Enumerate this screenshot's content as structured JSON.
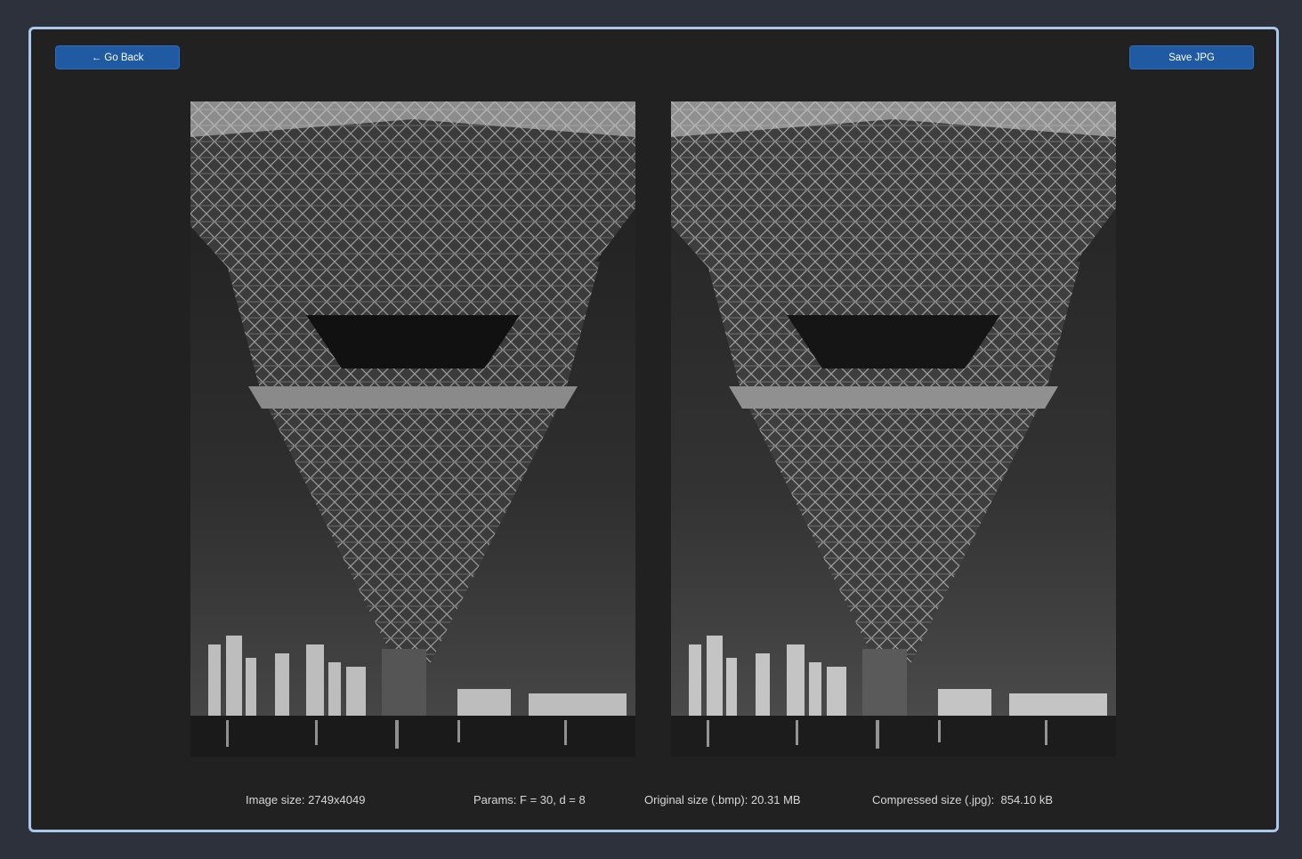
{
  "toolbar": {
    "back_label": "← Go Back",
    "save_label": "Save JPG"
  },
  "images": {
    "original_icon": "bridge-photo-original",
    "compressed_icon": "bridge-photo-compressed"
  },
  "stats": {
    "image_size": "Image size: 2749x4049",
    "params": "Params: F = 30, d = 8",
    "original_size": "Original size (.bmp): 20.31 MB",
    "compressed_size": "Compressed size (.jpg):  854.10 kB"
  },
  "colors": {
    "accent": "#1f5aa3",
    "window_border": "#a9c8ec",
    "background": "#2c313c",
    "panel": "#212121"
  }
}
